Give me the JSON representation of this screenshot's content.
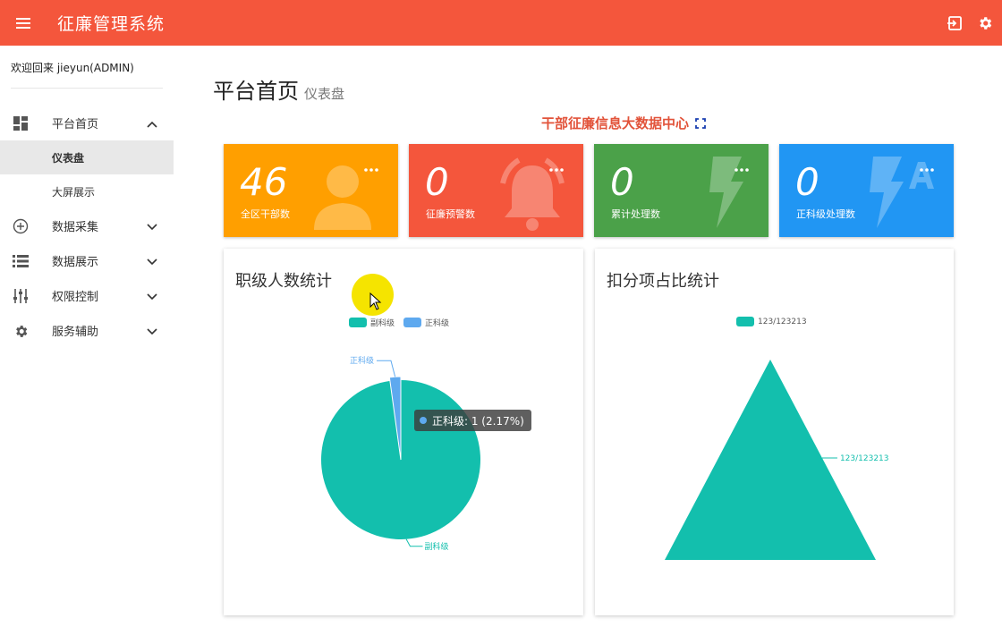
{
  "header": {
    "title": "征廉管理系统"
  },
  "sidebar": {
    "welcome": "欢迎回来 jieyun(ADMIN)",
    "items": [
      {
        "label": "平台首页",
        "expanded": true,
        "children": [
          {
            "label": "仪表盘",
            "active": true
          },
          {
            "label": "大屏展示"
          }
        ]
      },
      {
        "label": "数据采集"
      },
      {
        "label": "数据展示"
      },
      {
        "label": "权限控制"
      },
      {
        "label": "服务辅助"
      }
    ]
  },
  "page": {
    "title": "平台首页",
    "subtitle": "仪表盘",
    "bigdata_link": "干部征廉信息大数据中心"
  },
  "cards": [
    {
      "value": "46",
      "label": "全区干部数",
      "color": "#ff9f00",
      "icon": "person-icon"
    },
    {
      "value": "0",
      "label": "征廉预警数",
      "color": "#f4563c",
      "icon": "bell-icon"
    },
    {
      "value": "0",
      "label": "累计处理数",
      "color": "#4ba149",
      "icon": "bolt-icon"
    },
    {
      "value": "0",
      "label": "正科级处理数",
      "color": "#2196f3",
      "icon": "bolt-a-icon"
    }
  ],
  "rank_chart": {
    "title": "职级人数统计",
    "legend": [
      "副科级",
      "正科级"
    ],
    "tooltip": "正科级: 1 (2.17%)"
  },
  "deduction_chart": {
    "title": "扣分项占比统计",
    "legend": [
      "123/123213"
    ]
  },
  "chart_data": [
    {
      "type": "pie",
      "title": "职级人数统计",
      "labels": [
        "副科级",
        "正科级"
      ],
      "values": [
        45,
        1
      ],
      "colors": [
        "#13bfad",
        "#5ea9ef"
      ],
      "legend_position": "top"
    },
    {
      "type": "funnel",
      "title": "扣分项占比统计",
      "labels": [
        "123/123213"
      ],
      "values": [
        100
      ],
      "colors": [
        "#13bfad"
      ],
      "legend_position": "top"
    }
  ]
}
